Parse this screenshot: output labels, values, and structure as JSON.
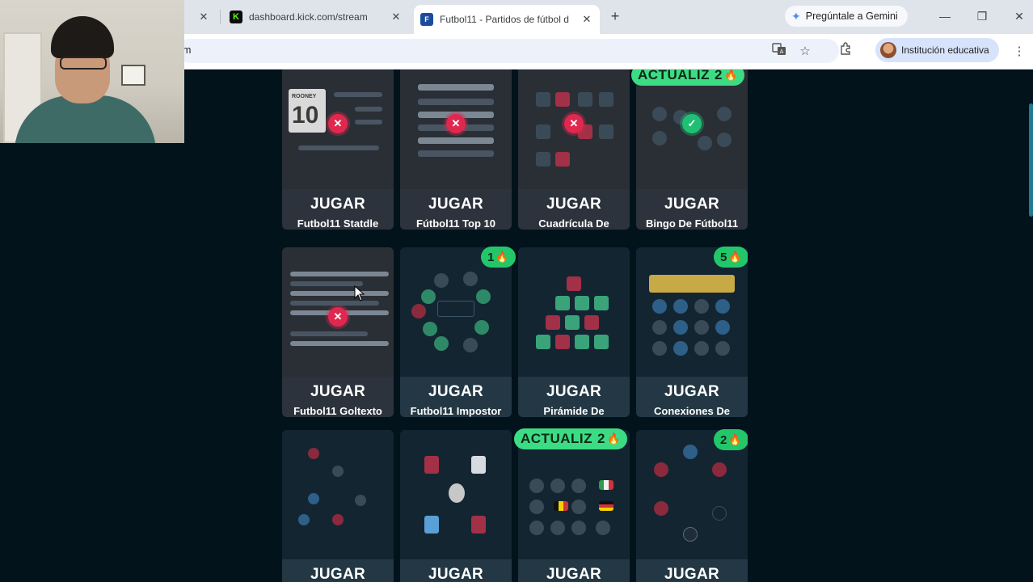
{
  "browser": {
    "tabs": [
      {
        "title": "",
        "active": false
      },
      {
        "title": "dashboard.kick.com/stream",
        "active": false,
        "favicon": "K"
      },
      {
        "title": "Futbol11 - Partidos de fútbol d",
        "active": true,
        "favicon": "F"
      }
    ],
    "new_tab": "+",
    "gemini_label": "Pregúntale a Gemini",
    "url_fragment": "m",
    "profile_label": "Institución educativa",
    "icons": [
      "translate-icon",
      "star-icon",
      "extensions-icon",
      "menu-icon"
    ]
  },
  "cards": [
    {
      "play": "JUGAR",
      "title": "Futbol11 Statdle",
      "status": "failed"
    },
    {
      "play": "JUGAR",
      "title": "Fútbol11 Top 10",
      "status": "failed"
    },
    {
      "play": "JUGAR",
      "title": "Cuadrícula De",
      "status": "failed"
    },
    {
      "play": "JUGAR",
      "title": "Bingo De Fútbol11",
      "status": "completed",
      "badge": "ACTUALIZ",
      "badge_count": "2"
    },
    {
      "play": "JUGAR",
      "title": "Futbol11 Goltexto",
      "status": "failed"
    },
    {
      "play": "JUGAR",
      "title": "Futbol11 Impostor",
      "badge_count": "1"
    },
    {
      "play": "JUGAR",
      "title": "Pirámide De"
    },
    {
      "play": "JUGAR",
      "title": "Conexiones De",
      "badge_count": "5"
    },
    {
      "play": "JUGAR",
      "title": ""
    },
    {
      "play": "JUGAR",
      "title": ""
    },
    {
      "play": "JUGAR",
      "title": "",
      "badge": "ACTUALIZ",
      "badge_count": "2"
    },
    {
      "play": "JUGAR",
      "title": "",
      "badge_count": "2"
    }
  ],
  "thumb_text": {
    "rooney_number": "10",
    "rooney_name": "ROONEY"
  },
  "colors": {
    "page_bg": "#03131c",
    "badge_green": "#23c76a",
    "fail_red": "#e0284f",
    "ok_green": "#1fbf74"
  }
}
